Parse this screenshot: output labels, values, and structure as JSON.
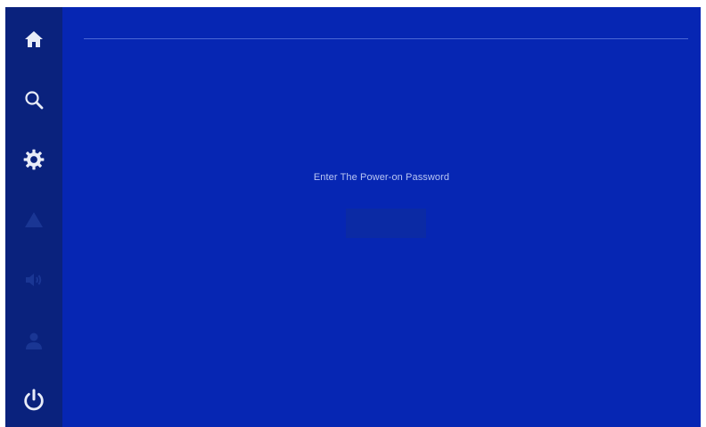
{
  "sidebar": {
    "items": [
      {
        "icon": "home-icon",
        "state": "active"
      },
      {
        "icon": "search-icon",
        "state": "active"
      },
      {
        "icon": "gear-icon",
        "state": "active"
      },
      {
        "icon": "warning-icon",
        "state": "disabled"
      },
      {
        "icon": "speaker-icon",
        "state": "disabled"
      },
      {
        "icon": "user-icon",
        "state": "disabled"
      },
      {
        "icon": "power-icon",
        "state": "active"
      }
    ]
  },
  "main": {
    "prompt": "Enter The Power-on Password",
    "password": {
      "value": "",
      "placeholder": ""
    }
  },
  "colors": {
    "background": "#0626b3",
    "sidebar": "#0a227d",
    "icon_active": "#e8ecf8",
    "icon_disabled": "#1a3694",
    "input": "#0b2aa4",
    "prompt_text": "#b9c6f3"
  }
}
